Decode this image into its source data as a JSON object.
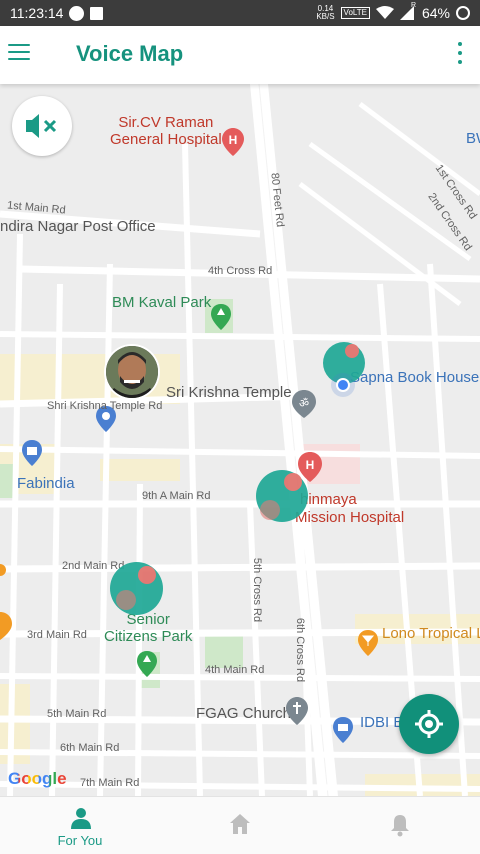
{
  "status_bar": {
    "time": "11:23:14",
    "speed_value": "0.14",
    "speed_unit": "KB/S",
    "network_badge": "VoLTE",
    "signal_tag": "R",
    "battery": "64%"
  },
  "app_bar": {
    "title": "Voice Map",
    "menu_icon": "hamburger-menu-icon",
    "overflow_icon": "more-vert-icon"
  },
  "map": {
    "pois": {
      "cv_raman_line1": "Sir.CV Raman",
      "cv_raman_line2": "General Hospital",
      "bw": "BW",
      "post_office": "ndira Nagar Post Office",
      "bm_kaval_park": "BM Kaval Park",
      "krishna_temple": "Sri Krishna Temple",
      "sapna": "Sapna Book House",
      "fabindia": "Fabindia",
      "chinmaya_line1": "hinmaya",
      "chinmaya_line2": "Mission Hospital",
      "senior_line1": "Senior",
      "senior_line2": "Citizens Park",
      "lono": "Lono Tropical L",
      "fgag": "FGAG Church",
      "idbi": "IDBI Ba"
    },
    "roads": {
      "r1st_main": "1st Main Rd",
      "r80_feet": "80 Feet Rd",
      "r1st_cross": "1st Cross Rd",
      "r2nd_cross": "2nd Cross Rd",
      "r4th_cross": "4th Cross Rd",
      "shri_krishna": "Shri Krishna Temple Rd",
      "r9th_a_main": "9th A Main Rd",
      "r2nd_main": "2nd Main Rd",
      "r3rd_main": "3rd Main Rd",
      "r5th_cross": "5th Cross Rd",
      "r6th_cross": "6th Cross Rd",
      "r4th_main": "4th Main Rd",
      "r5th_main": "5th Main Rd",
      "r6th_main": "6th Main Rd",
      "r7th_main": "7th Main Rd"
    },
    "google_logo": "Google",
    "controls": {
      "mute_icon": "volume-off-icon",
      "locate_icon": "my-location-icon"
    }
  },
  "bottom_nav": {
    "items": [
      {
        "label": "For You",
        "icon": "person-icon",
        "active": true
      },
      {
        "label": "",
        "icon": "home-icon",
        "active": false
      },
      {
        "label": "",
        "icon": "bell-icon",
        "active": false
      }
    ]
  },
  "colors": {
    "accent": "#1b9a86",
    "marker": "#1fa896",
    "hospital": "#e45b5b"
  }
}
